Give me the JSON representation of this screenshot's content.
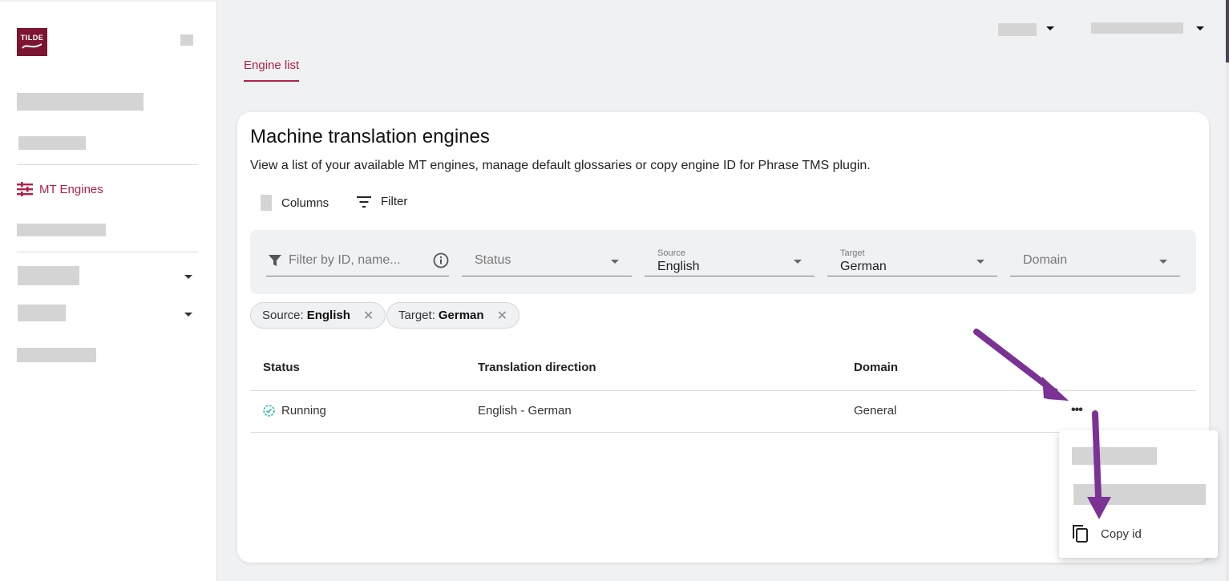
{
  "brand": {
    "logo_text": "TILDE",
    "accent": "#b0214a",
    "logo_bg": "#7d1530"
  },
  "sidebar": {
    "active_item": {
      "label": "MT Engines",
      "icon": "sliders-icon"
    }
  },
  "header": {
    "tabs": [
      {
        "label": "Engine list",
        "active": true
      }
    ]
  },
  "page": {
    "title": "Machine translation engines",
    "subtitle": "View a list of your available MT engines, manage default glossaries or copy engine ID for Phrase TMS plugin.",
    "toolbar": {
      "columns_label": "Columns",
      "filter_label": "Filter"
    }
  },
  "filters": {
    "search": {
      "placeholder": "Filter by ID, name...",
      "value": ""
    },
    "status": {
      "placeholder": "Status",
      "value": ""
    },
    "source": {
      "label": "Source",
      "value": "English"
    },
    "target": {
      "label": "Target",
      "value": "German"
    },
    "domain": {
      "placeholder": "Domain",
      "value": ""
    }
  },
  "chips": [
    {
      "key": "Source:",
      "value": "English"
    },
    {
      "key": "Target:",
      "value": "German"
    }
  ],
  "table": {
    "columns": [
      "Status",
      "Translation direction",
      "Domain"
    ],
    "rows": [
      {
        "status": "Running",
        "status_color": "#26b5a8",
        "direction": "English - German",
        "domain": "General"
      }
    ]
  },
  "context_menu": {
    "items": [
      {
        "label": "Copy id",
        "icon": "copy-icon"
      }
    ]
  },
  "annotation_color": "#7b3294"
}
